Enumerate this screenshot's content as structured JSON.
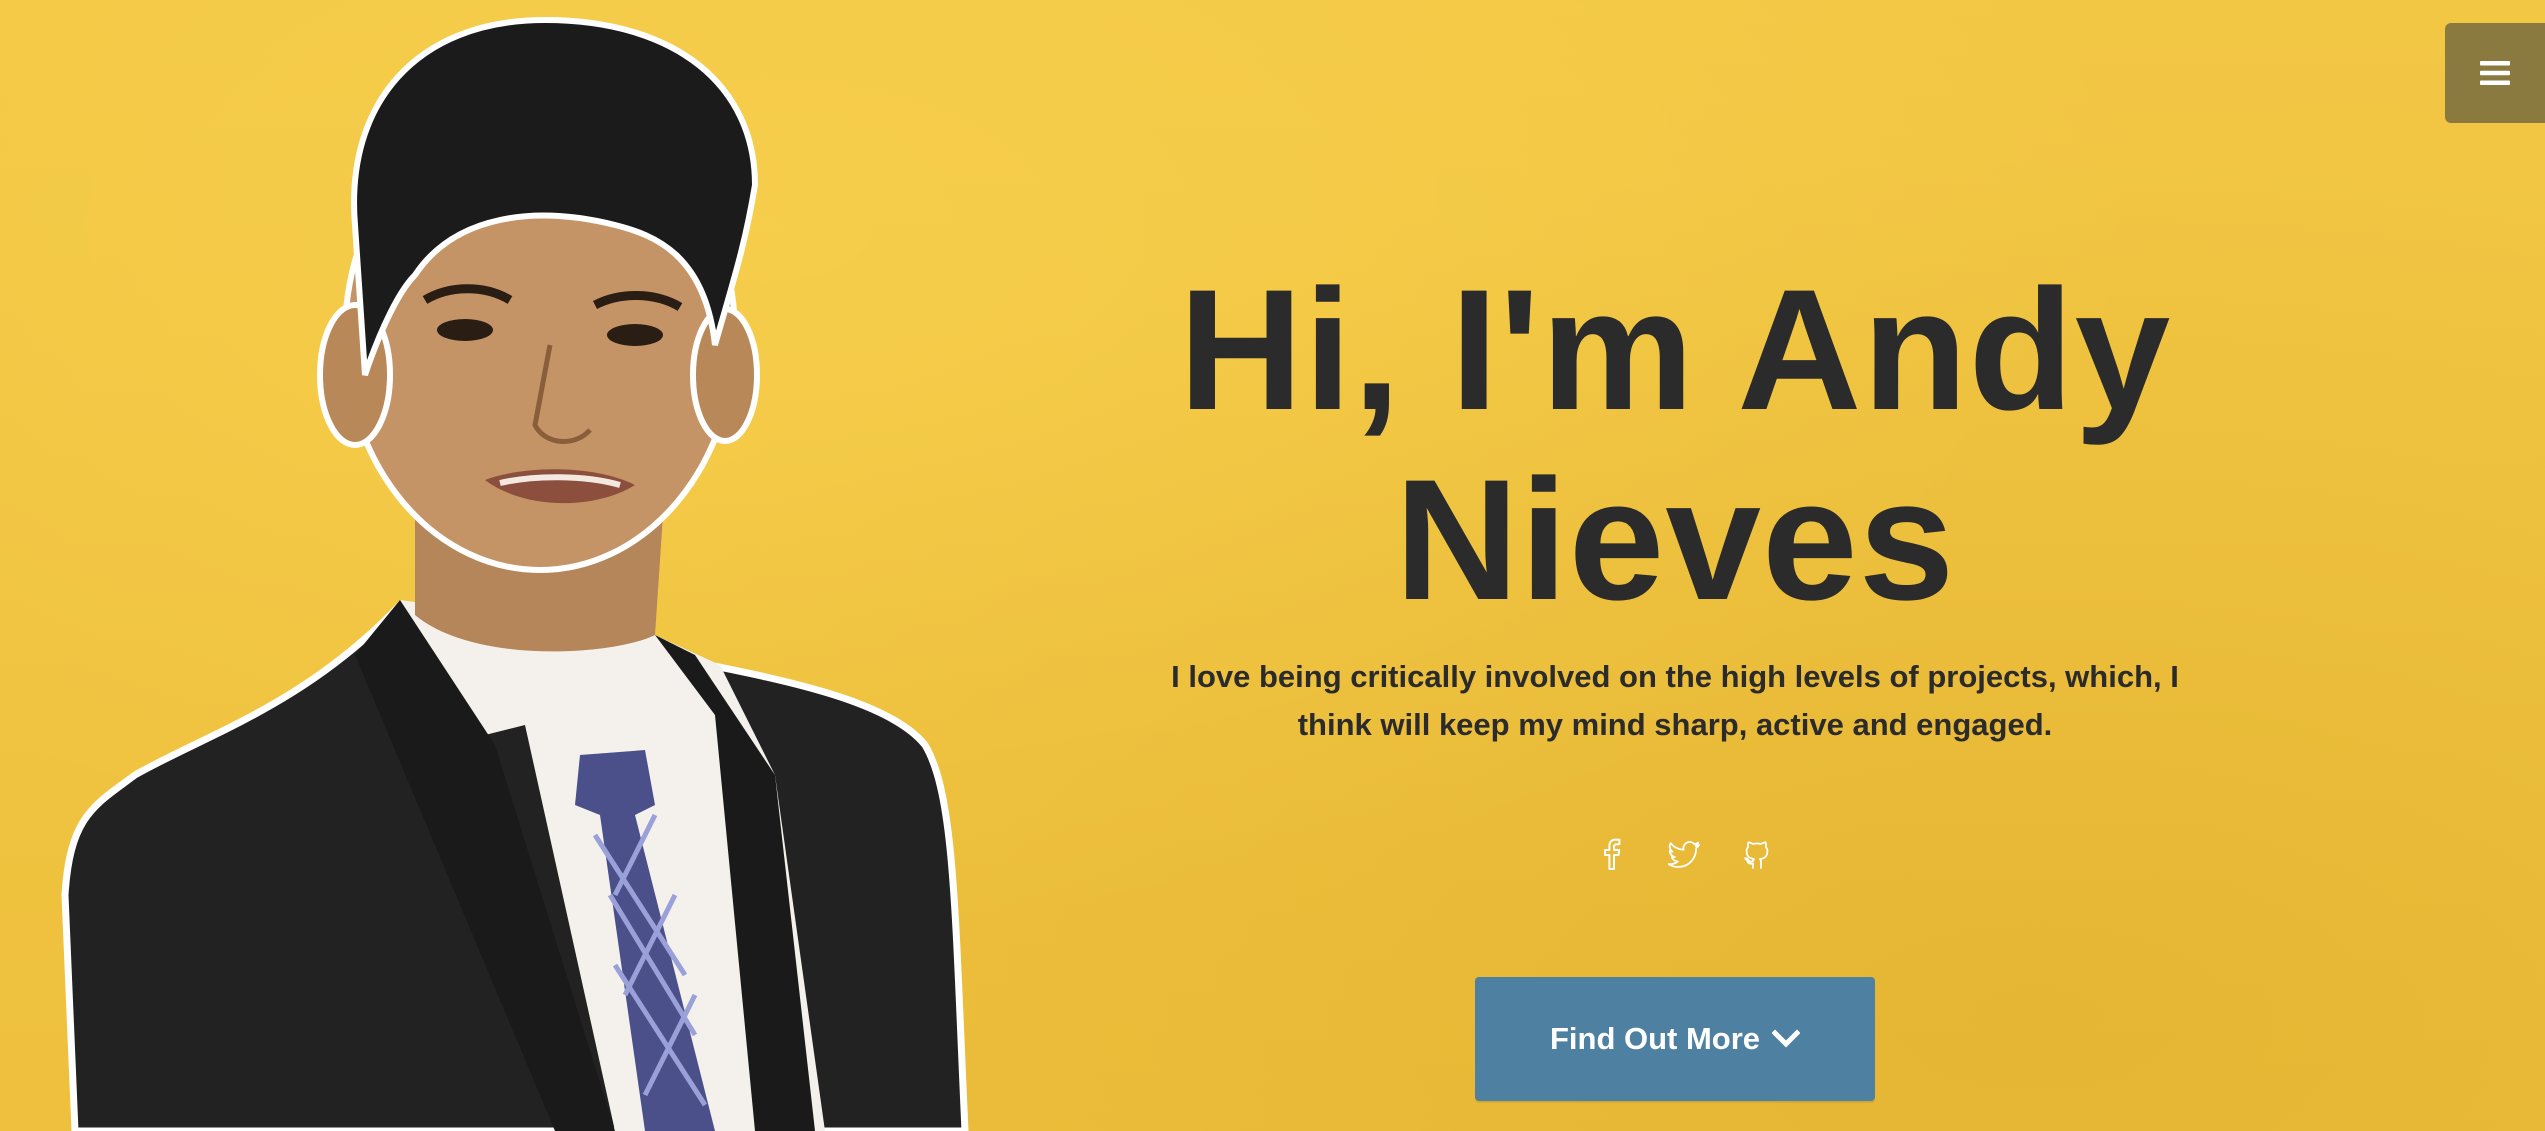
{
  "menu": {
    "icon": "hamburger-menu-icon"
  },
  "portrait": {
    "alt": "Portrait of Andy Nieves in a suit"
  },
  "hero": {
    "title_line1": "Hi, I'm Andy",
    "title_line2": "Nieves",
    "subtitle": "I love being critically involved on the high levels of projects, which, I think will keep my mind sharp, active and engaged."
  },
  "social": [
    {
      "icon": "facebook-icon"
    },
    {
      "icon": "twitter-icon"
    },
    {
      "icon": "github-icon"
    }
  ],
  "cta": {
    "label": "Find Out More",
    "icon": "chevron-down-icon"
  },
  "colors": {
    "background": "#f0c544",
    "menu_bg": "#8b7a3f",
    "cta_bg": "#4e80a1",
    "text": "#2b2b2b"
  }
}
